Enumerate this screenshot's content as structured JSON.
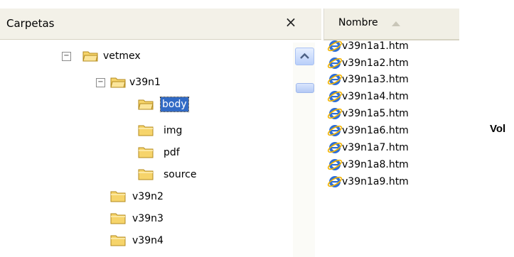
{
  "folders_pane": {
    "title": "Carpetas",
    "close_symbol": "×",
    "tree": [
      {
        "label": "vetmex",
        "expander": "−",
        "icon": "folder-open-icon"
      },
      {
        "label": "v39n1",
        "expander": "−",
        "icon": "folder-open-icon"
      },
      {
        "label": "body",
        "selected": true,
        "icon": "folder-open-icon"
      },
      {
        "label": "img",
        "icon": "folder-icon"
      },
      {
        "label": "pdf",
        "icon": "folder-icon"
      },
      {
        "label": "source",
        "icon": "folder-icon"
      },
      {
        "label": "v39n2",
        "icon": "folder-icon"
      },
      {
        "label": "v39n3",
        "icon": "folder-icon"
      },
      {
        "label": "v39n4",
        "icon": "folder-icon"
      }
    ]
  },
  "files_pane": {
    "column_name": "Nombre",
    "sort": "ascending",
    "files": [
      "v39n1a1.htm",
      "v39n1a2.htm",
      "v39n1a3.htm",
      "v39n1a4.htm",
      "v39n1a5.htm",
      "v39n1a6.htm",
      "v39n1a7.htm",
      "v39n1a8.htm",
      "v39n1a9.htm"
    ]
  },
  "side_text": "Vol",
  "colors": {
    "selection": "#316ac5",
    "folder_fill": "#f6d46b",
    "folder_stroke": "#b38a1d",
    "header_bg": "#f3f1e8",
    "ie_blue": "#2f6fd6"
  }
}
